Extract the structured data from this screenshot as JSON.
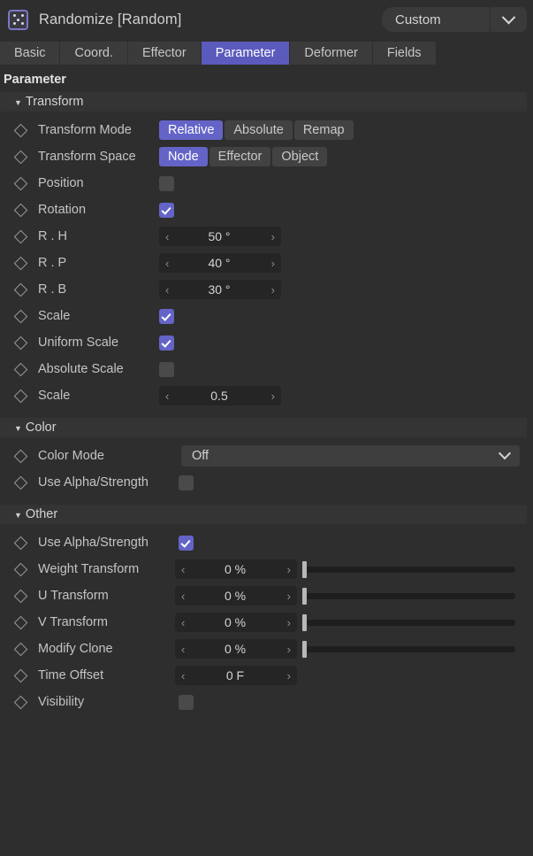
{
  "window": {
    "object_icon": "dice-icon",
    "title": "Randomize [Random]",
    "preset_value": "Custom",
    "preset_chevron": "chevron-down-icon"
  },
  "tabs": [
    {
      "label": "Basic",
      "active": false
    },
    {
      "label": "Coord.",
      "active": false
    },
    {
      "label": "Effector",
      "active": false
    },
    {
      "label": "Parameter",
      "active": true
    },
    {
      "label": "Deformer",
      "active": false
    },
    {
      "label": "Fields",
      "active": false
    }
  ],
  "panel": {
    "title": "Parameter"
  },
  "groups": {
    "transform": {
      "label": "Transform",
      "rows": {
        "transform_mode": {
          "label": "Transform Mode",
          "options": [
            "Relative",
            "Absolute",
            "Remap"
          ],
          "selected": "Relative"
        },
        "transform_space": {
          "label": "Transform Space",
          "options": [
            "Node",
            "Effector",
            "Object"
          ],
          "selected": "Node"
        },
        "position": {
          "label": "Position",
          "checked": false
        },
        "rotation": {
          "label": "Rotation",
          "checked": true
        },
        "r_h": {
          "label": "R . H",
          "value": "50 °"
        },
        "r_p": {
          "label": "R . P",
          "value": "40 °"
        },
        "r_b": {
          "label": "R . B",
          "value": "30 °"
        },
        "scale": {
          "label": "Scale",
          "checked": true
        },
        "uniform_scale": {
          "label": "Uniform Scale",
          "checked": true
        },
        "absolute_scale": {
          "label": "Absolute Scale",
          "checked": false
        },
        "scale_value": {
          "label": "Scale",
          "value": "0.5"
        }
      }
    },
    "color": {
      "label": "Color",
      "rows": {
        "color_mode": {
          "label": "Color Mode",
          "value": "Off"
        },
        "use_alpha_strength": {
          "label": "Use Alpha/Strength",
          "checked": false
        }
      }
    },
    "other": {
      "label": "Other",
      "rows": {
        "use_alpha_strength": {
          "label": "Use Alpha/Strength",
          "checked": true
        },
        "weight_transform": {
          "label": "Weight Transform",
          "value": "0 %",
          "slider": 0
        },
        "u_transform": {
          "label": "U Transform",
          "value": "0 %",
          "slider": 0
        },
        "v_transform": {
          "label": "V Transform",
          "value": "0 %",
          "slider": 0
        },
        "modify_clone": {
          "label": "Modify Clone",
          "value": "0 %",
          "slider": 0
        },
        "time_offset": {
          "label": "Time Offset",
          "value": "0 F"
        },
        "visibility": {
          "label": "Visibility",
          "checked": false
        }
      }
    }
  },
  "icons": {
    "keyframe": "keyframe-diamond-icon",
    "stepper_left": "‹",
    "stepper_right": "›"
  },
  "colors": {
    "accent": "#6464c8",
    "tab_accent": "#5b5bbe",
    "panel_bg": "#2e2e2e",
    "field_bg": "#252525",
    "group_bg": "#343434"
  }
}
